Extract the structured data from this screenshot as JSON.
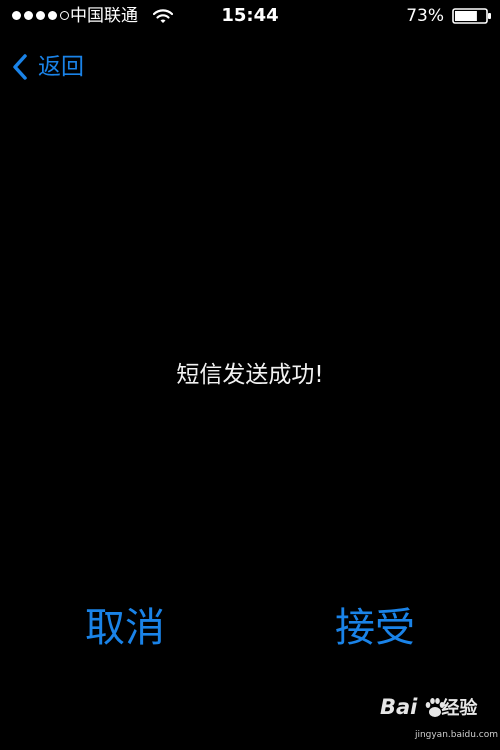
{
  "status_bar": {
    "signal_strength": 4,
    "signal_max": 5,
    "carrier": "中国联通",
    "time": "15:44",
    "battery_percent_text": "73%",
    "battery_level": 0.73,
    "icons": [
      "signal-dots-icon",
      "wifi-icon",
      "battery-icon"
    ]
  },
  "nav": {
    "back_label": "返回",
    "back_icon": "chevron-left-icon"
  },
  "message": {
    "text": "短信发送成功!"
  },
  "actions": {
    "cancel_label": "取消",
    "accept_label": "接受"
  },
  "watermark": {
    "logo_text_left": "Bai",
    "logo_text_right": "经验",
    "site": "jingyan.baidu.com"
  },
  "colors": {
    "background": "#000000",
    "accent": "#1a83e8",
    "text": "#ffffff"
  }
}
